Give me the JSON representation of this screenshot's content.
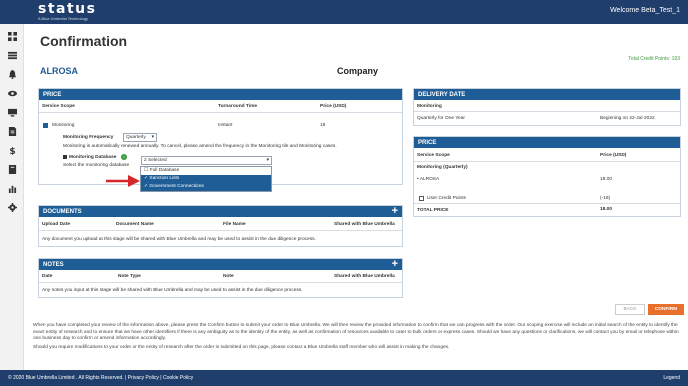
{
  "header": {
    "logo_text": "status",
    "logo_tagline": "A Blue Umbrella Technology",
    "welcome": "Welcome Beta_Test_1"
  },
  "sidebar": {
    "icons": [
      "dashboard-icon",
      "list-icon",
      "bell-icon",
      "eye-icon",
      "monitor-icon",
      "document-icon",
      "dollar-icon",
      "book-icon",
      "bar-chart-icon",
      "gear-icon"
    ]
  },
  "page": {
    "title": "Confirmation",
    "credit_points": "Total Credit Points: 193",
    "entity_name": "ALROSA",
    "entity_type": "Company"
  },
  "price_panel": {
    "title": "PRICE",
    "columns": [
      "Service Scope",
      "Turnaround Time",
      "Price (USD)"
    ],
    "row": {
      "scope": "Monitoring",
      "turnaround": "Instant",
      "price": "18"
    },
    "frequency_label": "Monitoring Frequency",
    "frequency_value": "Quarterly",
    "frequency_note": "Monitoring is automatically renewed annually. To cancel, please amend the frequency in the Monitoring tile and Monitoring cases.",
    "database_label": "Monitoring Database",
    "database_note": "Select the monitoring database",
    "database_value": "2 Selected",
    "database_options": [
      {
        "label": "Full Database",
        "selected": false
      },
      {
        "label": "Sanction Lists",
        "selected": true
      },
      {
        "label": "Government Connections",
        "selected": true
      }
    ]
  },
  "documents_panel": {
    "title": "DOCUMENTS",
    "columns": [
      "Upload Date",
      "Document Name",
      "File Name",
      "Shared with Blue Umbrella"
    ],
    "note": "Any document you upload at this stage will be shared with Blue Umbrella and may be used to assist in the due diligence process."
  },
  "notes_panel": {
    "title": "NOTES",
    "columns": [
      "Date",
      "Note Type",
      "Note",
      "Shared with Blue Umbrella"
    ],
    "note": "Any notes you input at this stage will be shared with Blue Umbrella and may be used to assist in the due diligence process."
  },
  "delivery_panel": {
    "title": "DELIVERY DATE",
    "service": "Monitoring",
    "frequency": "Quarterly for One Year",
    "date": "Beginning on 22-Jul-2022"
  },
  "price_summary": {
    "title": "PRICE",
    "columns": [
      "Service Scope",
      "Price (USD)"
    ],
    "group": "Monitoring (Quarterly)",
    "item": "• ALROSA",
    "item_price": "18.00",
    "credit_label": "User Credit Points",
    "credit_value": "(-18)",
    "total_label": "TOTAL PRICE",
    "total_value": "18.00"
  },
  "actions": {
    "back": "BACK",
    "confirm": "CONFIRM"
  },
  "notice": {
    "p1": "When you have completed your review of the information above, please press the Confirm button to submit your order to Blue Umbrella. We will then review the provided information to confirm that we can progress with the order. Our scoping exercise will include an initial search of the entity to identify the exact entity of research and to ensure that we have other identifiers if there is any ambiguity as to the identity of the entity, as well as confirmation of resources available to cater to bulk orders or express cases. Should we have any questions or clarifications, we will contact you by email or telephone within one business day to confirm or amend information accordingly.",
    "p2": "Should you require modifications to your order or the entity of research after the order is submitted on this page, please contact a Blue Umbrella staff member who will assist in making the changes."
  },
  "footer": {
    "left": "© 2020 Blue Umbrella Limited . All Rights Reserved. | Privacy Policy | Cookie Policy",
    "right": "Legend"
  },
  "colors": {
    "navy": "#1f3e6b",
    "panel_blue": "#1f5d96",
    "confirm_orange": "#e8702a",
    "credit_green": "#3d9b3d",
    "arrow_red": "#d7262b"
  }
}
